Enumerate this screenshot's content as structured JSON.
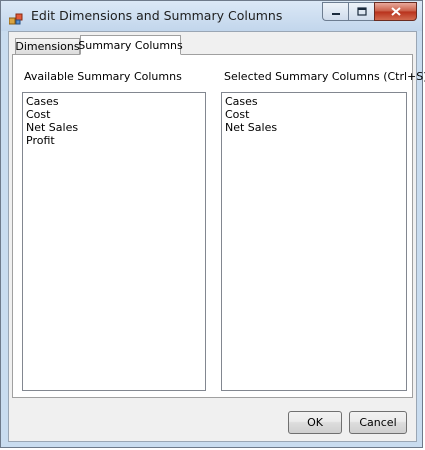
{
  "window": {
    "title": "Edit Dimensions and Summary Columns"
  },
  "titlebar": {
    "buttons": [
      "minimize",
      "maximize",
      "close"
    ]
  },
  "tabs": [
    {
      "label": "Dimensions",
      "selected": false
    },
    {
      "label": "Summary Columns",
      "selected": true
    }
  ],
  "available": {
    "label": "Available Summary Columns",
    "items": [
      "Cases",
      "Cost",
      "Net Sales",
      "Profit"
    ]
  },
  "selected": {
    "label": "Selected Summary Columns (Ctrl+S)",
    "items": [
      "Cases",
      "Cost",
      "Net Sales"
    ]
  },
  "footer": {
    "ok_label": "OK",
    "cancel_label": "Cancel"
  },
  "colors": {
    "title_bar": "#c9dcef",
    "close_button": "#c85b44",
    "dialog_background": "#f0f0f0"
  }
}
